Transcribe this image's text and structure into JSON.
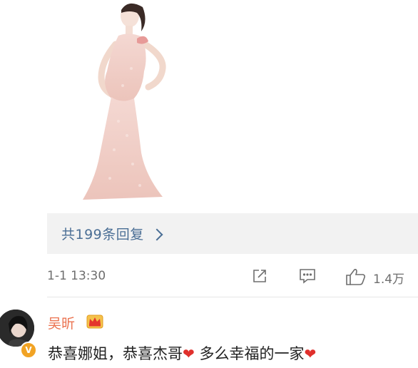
{
  "post": {
    "image_alt": "pregnant woman in pink lace gown",
    "replies_label": "共199条回复",
    "timestamp": "1-1 13:30",
    "like_count": "1.4万",
    "icons": [
      "repost-icon",
      "comment-icon",
      "like-icon"
    ]
  },
  "comment": {
    "username": "吴昕",
    "badge_icon": "crown-icon",
    "verified_icon": "verified-v-icon",
    "text_part1": "恭喜娜姐，恭喜杰哥",
    "text_part2": " 多么幸福的一家",
    "emoji": "❤"
  },
  "colors": {
    "link": "#4a6e95",
    "username": "#eb7350",
    "muted": "#6e6e6e",
    "heart": "#e0302c",
    "verified": "#f1a324"
  }
}
